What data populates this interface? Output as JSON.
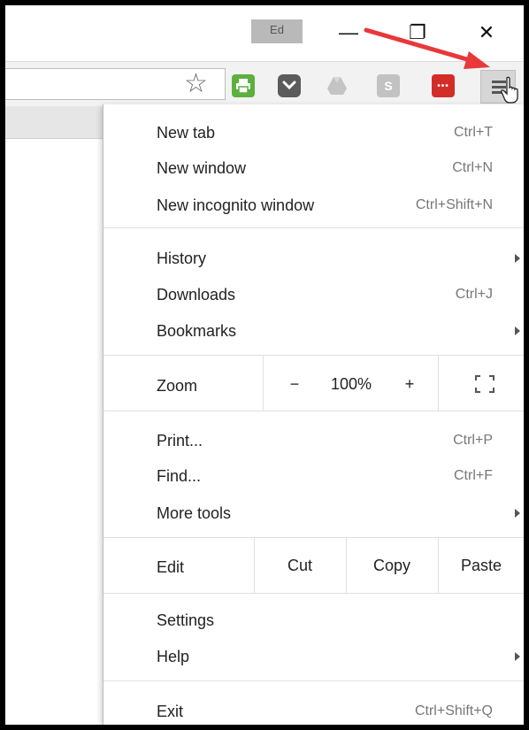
{
  "window": {
    "profile_label": "Ed",
    "minimize_glyph": "—",
    "restore_glyph": "❐",
    "close_glyph": "✕"
  },
  "toolbar": {
    "bookmark_star_glyph": "☆",
    "extensions": [
      {
        "name": "print-friendly",
        "color": "#5cb03e",
        "glyph": "⎙"
      },
      {
        "name": "pocket",
        "color": "#5b5b5b",
        "glyph": "▾"
      },
      {
        "name": "google-drive",
        "color": "#bdbdbd",
        "glyph": "▲"
      },
      {
        "name": "s-extension",
        "color": "#c2c2c2",
        "glyph": "S"
      },
      {
        "name": "lastpass",
        "color": "#d32d27",
        "glyph": "•••"
      }
    ]
  },
  "menu": {
    "new_tab": {
      "label": "New tab",
      "shortcut": "Ctrl+T"
    },
    "new_window": {
      "label": "New window",
      "shortcut": "Ctrl+N"
    },
    "new_incognito": {
      "label": "New incognito window",
      "shortcut": "Ctrl+Shift+N"
    },
    "history": {
      "label": "History"
    },
    "downloads": {
      "label": "Downloads",
      "shortcut": "Ctrl+J"
    },
    "bookmarks": {
      "label": "Bookmarks"
    },
    "zoom": {
      "label": "Zoom",
      "minus": "−",
      "value": "100%",
      "plus": "+"
    },
    "print": {
      "label": "Print...",
      "shortcut": "Ctrl+P"
    },
    "find": {
      "label": "Find...",
      "shortcut": "Ctrl+F"
    },
    "more_tools": {
      "label": "More tools"
    },
    "edit": {
      "label": "Edit",
      "cut": "Cut",
      "copy": "Copy",
      "paste": "Paste"
    },
    "settings": {
      "label": "Settings"
    },
    "help": {
      "label": "Help"
    },
    "exit": {
      "label": "Exit",
      "shortcut": "Ctrl+Shift+Q"
    }
  },
  "colors": {
    "annotation_arrow": "#e8383a",
    "menu_button_bg": "#d6d6d6"
  }
}
